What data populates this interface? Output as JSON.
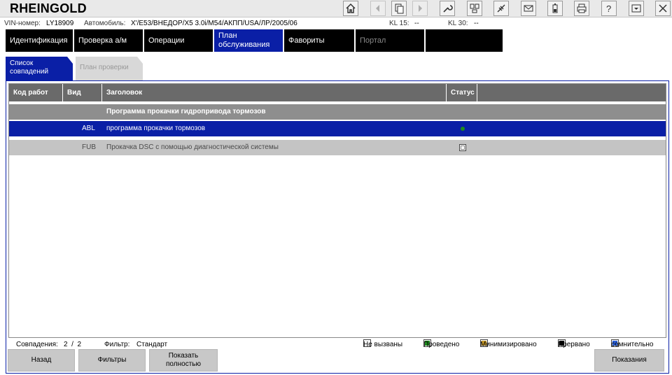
{
  "app": {
    "title": "RHEINGOLD"
  },
  "toolbar": {
    "icons": [
      "home-icon",
      "back-icon",
      "copy-icon",
      "forward-icon",
      "wrench-icon",
      "compare-icon",
      "connection-icon",
      "mail-icon",
      "battery-icon",
      "print-icon",
      "help-icon",
      "minimize-icon",
      "close-icon"
    ]
  },
  "vehicle": {
    "vin_label": "VIN-номер:",
    "vin_value": "LY18909",
    "car_label": "Автомобиль:",
    "car_value": "X'/E53/ВНЕДОР/X5 3.0i/M54/АКПП/USA/ЛР/2005/06",
    "kl15_label": "KL 15:",
    "kl15_value": "--",
    "kl30_label": "KL 30:",
    "kl30_value": "--"
  },
  "nav": {
    "tabs": [
      "Идентификация",
      "Проверка а/м",
      "Операции",
      "План обслуживания",
      "Фавориты",
      "Портал",
      ""
    ]
  },
  "subtabs": {
    "active": "Список совпадений",
    "inactive": "План проверки"
  },
  "table": {
    "headers": {
      "code": "Код работ",
      "type": "Вид",
      "title": "Заголовок",
      "status": "Статус"
    },
    "group": "Программа прокачки гидропривода тормозов",
    "rows": [
      {
        "code": "",
        "type": "ABL",
        "title": "программа прокачки тормозов",
        "status": "Проведено"
      },
      {
        "code": "",
        "type": "FUB",
        "title": "Прокачка DSC с помощью диагностической системы",
        "status": "Не вызваны"
      }
    ]
  },
  "footer": {
    "matches_label": "Совпадения:",
    "matches_value": "2  /  2",
    "filter_label": "Фильтр:",
    "filter_value": "Стандарт"
  },
  "legend": [
    {
      "label": "Не вызваны",
      "color": "#ffffff"
    },
    {
      "label": "Проведено",
      "color": "#1e8a1e"
    },
    {
      "label": "Минимизировано",
      "color": "#c89a28"
    },
    {
      "label": "Прервано",
      "color": "#000000"
    },
    {
      "label": "сомнительно",
      "color": "#2a5fd8"
    }
  ],
  "buttons": {
    "back": "Назад",
    "filters": "Фильтры",
    "show_all": "Показать полностью",
    "readings": "Показания"
  },
  "colors": {
    "accent": "#0a1fa6",
    "nav_bg": "#000000",
    "header_bg": "#6a6a6a"
  }
}
